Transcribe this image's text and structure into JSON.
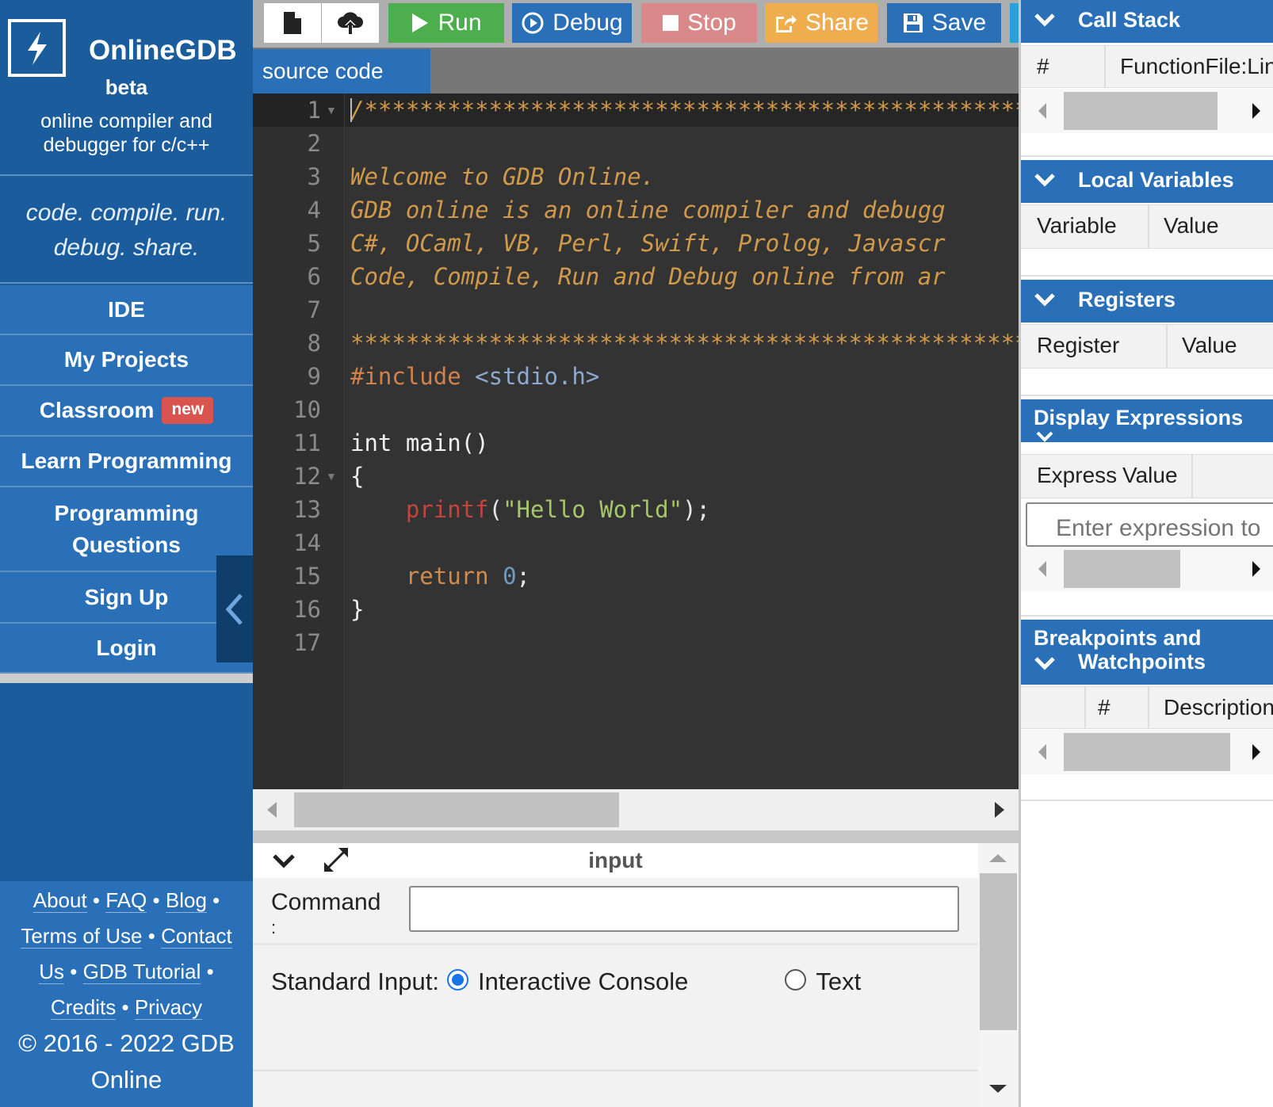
{
  "brand": {
    "title": "OnlineGDB",
    "beta": "beta",
    "tagline_1": "online compiler and",
    "tagline_2": "debugger for c/c++"
  },
  "motto": {
    "line_1": "code. compile. run.",
    "line_2": "debug. share."
  },
  "nav": {
    "ide": "IDE",
    "projects": "My Projects",
    "classroom": "Classroom",
    "classroom_badge": "new",
    "learn": "Learn Programming",
    "questions_1": "Programming",
    "questions_2": "Questions",
    "signup": "Sign Up",
    "login": "Login"
  },
  "footer": {
    "about": "About",
    "faq": "FAQ",
    "blog": "Blog",
    "terms": "Terms of Use",
    "contact_1": "Contact",
    "contact_2": "Us",
    "tutorial": "GDB Tutorial",
    "credits": "Credits",
    "privacy": "Privacy",
    "bullet": "•",
    "copyright_1": "© 2016 - 2022 GDB",
    "copyright_2": "Online"
  },
  "toolbar": {
    "run": "Run",
    "debug": "Debug",
    "stop": "Stop",
    "share": "Share",
    "save": "Save",
    "colors": {
      "run": "#4cae4c",
      "debug": "#2a70b8",
      "stop": "#d9898a",
      "share": "#f0ad4e",
      "save": "#2a70b8"
    }
  },
  "tabs": {
    "source": "source code"
  },
  "editor": {
    "line_numbers": [
      "1",
      "2",
      "3",
      "4",
      "5",
      "6",
      "7",
      "8",
      "9",
      "10",
      "11",
      "12",
      "13",
      "14",
      "15",
      "16",
      "17"
    ],
    "header_stars": "/************************************************************",
    "welcome": "Welcome to GDB Online.",
    "desc_1": "GDB online is an online compiler and debugg",
    "desc_2": "C#, OCaml, VB, Perl, Swift, Prolog, Javascr",
    "desc_3": "Code, Compile, Run and Debug online from ar",
    "footer_stars": "*************************************************************",
    "include_kw": "#include",
    "include_hdr": "<stdio.h>",
    "main_sig": "int main()",
    "brace_open": "{",
    "printf_fn": "printf",
    "printf_open": "(",
    "printf_str": "\"Hello World\"",
    "printf_close": ");",
    "return_kw": "return",
    "return_val": "0",
    "semicolon": ";",
    "brace_close": "}"
  },
  "io": {
    "title": "input",
    "command_label": "Command",
    "stdin_label": "Standard Input:",
    "option_console": "Interactive Console",
    "option_text": "Text",
    "selected": "Interactive Console"
  },
  "debug": {
    "call_stack": "Call Stack",
    "cs_col_num": "#",
    "cs_col_fn": "FunctionFile:Lin",
    "local_vars": "Local Variables",
    "lv_col_var": "Variable",
    "lv_col_val": "Value",
    "registers": "Registers",
    "rg_col_reg": "Register",
    "rg_col_val": "Value",
    "display_expr": "Display Expressions",
    "de_col_expr": "Express",
    "de_col_val": "Value",
    "expr_placeholder": "Enter expression to",
    "breakpoints_1": "Breakpoints and",
    "breakpoints_2": "Watchpoints",
    "bp_col_num": "#",
    "bp_col_desc": "Description"
  }
}
